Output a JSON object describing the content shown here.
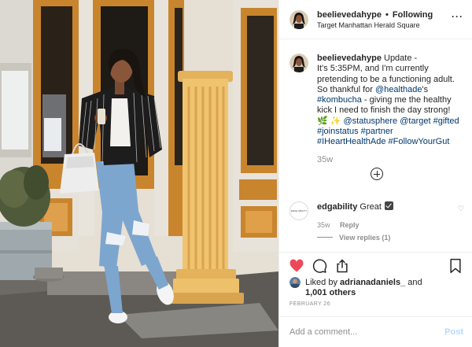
{
  "header": {
    "username": "beelievedahype",
    "separator": "•",
    "follow_status": "Following",
    "location": "Target Manhattan Herald Square",
    "more_icon": "more-horizontal-icon"
  },
  "caption": {
    "username": "beelievedahype",
    "lines": [
      "Update -",
      "It's 5:35PM, and I'm currently",
      "pretending to be a functioning adult.",
      "So thankful for ",
      "'s",
      " - giving me the healthy",
      "kick I need to finish the day strong!"
    ],
    "mention_healthade": "@healthade",
    "tag_kombucha": "#kombucha",
    "emojis": "🌿 ✨",
    "mention_statusphere": "@statusphere",
    "mention_target": "@target",
    "tag_gifted": "#gifted",
    "tag_joinstatus": "#joinstatus",
    "tag_partner": "#partner",
    "tag_iheart": "#IHeartHealthAde",
    "tag_follow": "#FollowYourGut",
    "time": "35w"
  },
  "comments": [
    {
      "username": "edgability",
      "text": "Great",
      "avatar_text": "EDGE ABILITY",
      "time": "35w",
      "reply_label": "Reply",
      "view_replies": "View replies (1)"
    }
  ],
  "actions": {
    "like_icon": "heart-icon",
    "like_color": "#ed4956",
    "comment_icon": "comment-icon",
    "share_icon": "share-icon",
    "save_icon": "bookmark-icon"
  },
  "likes": {
    "prefix": "Liked by ",
    "user": "adrianadaniels_",
    "conjunction": " and",
    "count": "1,001 others"
  },
  "date": "FEBRUARY 26",
  "add_comment": {
    "placeholder": "Add a comment...",
    "post_label": "Post"
  },
  "colors": {
    "link": "#00376b",
    "muted": "#8e8e8e",
    "post_disabled": "#b3dbff"
  }
}
